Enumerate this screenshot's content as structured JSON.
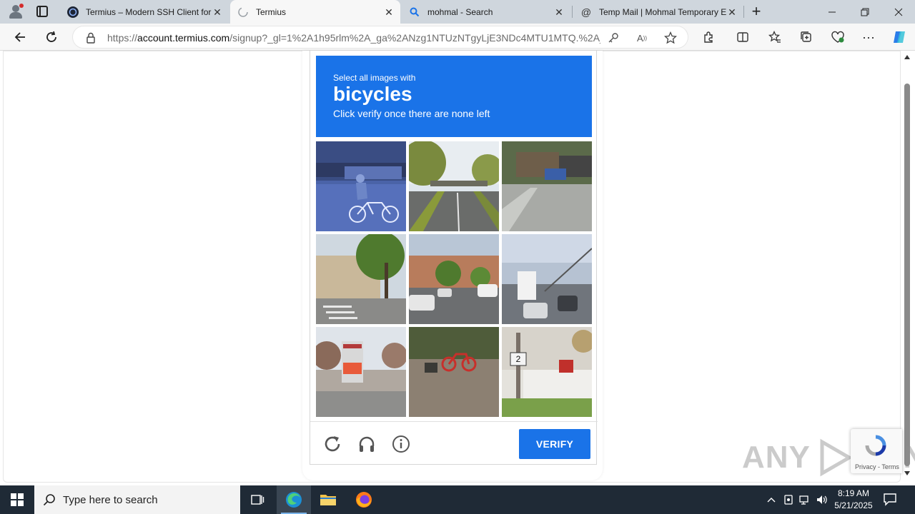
{
  "browser": {
    "tabs": [
      {
        "title": "Termius – Modern SSH Client for",
        "favicon": "termius-icon",
        "active": false
      },
      {
        "title": "Termius",
        "favicon": "loading-icon",
        "active": true
      },
      {
        "title": "mohmal - Search",
        "favicon": "search-icon",
        "active": false
      },
      {
        "title": "Temp Mail | Mohmal Temporary E",
        "favicon": "at-icon",
        "active": false
      }
    ],
    "url_prefix": "https://",
    "url_host": "account.termius.com",
    "url_path": "/signup?_gl=1%2A1h95rlm%2A_ga%2ANzg1NTUzNTgyLjE3NDc4MTU1MTQ.%2A_..."
  },
  "captcha": {
    "instruction_small": "Select all images with",
    "target": "bicycles",
    "instruction_sub": "Click verify once there are none left",
    "verify_label": "VERIFY",
    "tiles": [
      "cyclist-street",
      "bridge-road",
      "shanty-street",
      "tree-crosswalk",
      "parking-lot",
      "highway-truck",
      "bus-stop-sign",
      "red-bicycles",
      "railing-bridge"
    ]
  },
  "recaptcha_badge": {
    "terms": "Privacy - Terms"
  },
  "watermark": {
    "left": "ANY",
    "right": "RUN"
  },
  "taskbar": {
    "search_placeholder": "Type here to search",
    "time": "8:19 AM",
    "date": "5/21/2025"
  },
  "colors": {
    "accent": "#1a73e8",
    "taskbar": "#1f2a36",
    "tabstrip": "#cfd6dd"
  }
}
